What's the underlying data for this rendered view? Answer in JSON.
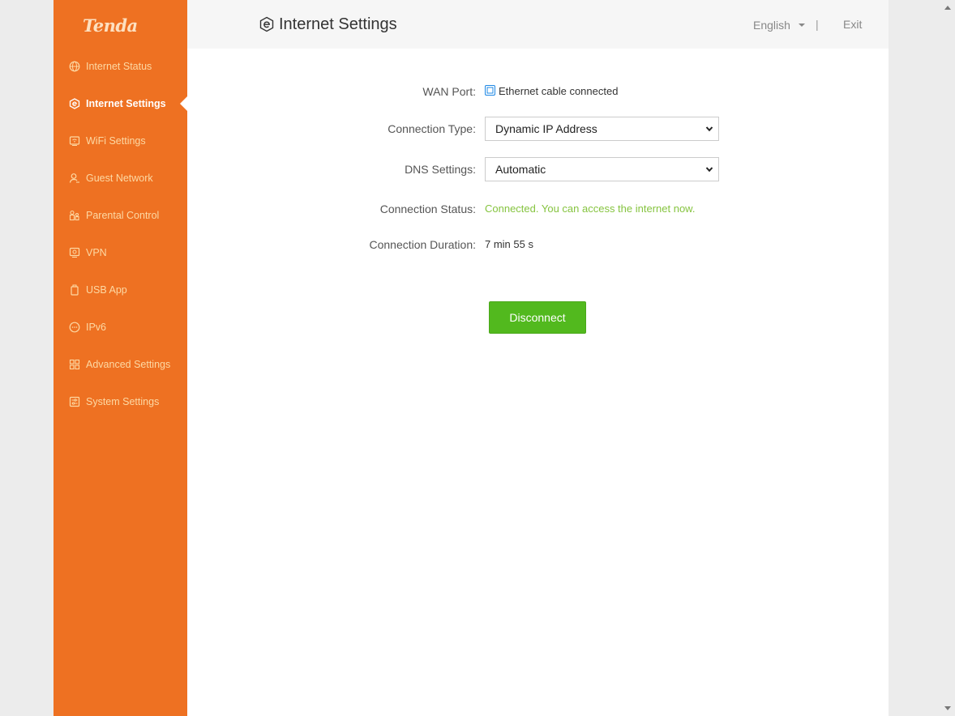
{
  "brand": {
    "logo_text": "Tenda"
  },
  "header": {
    "title": "Internet Settings",
    "title_icon": "internet-settings-icon",
    "language": "English",
    "divider": "|",
    "exit_label": "Exit"
  },
  "sidebar": {
    "accent_color": "#ee7122",
    "items": [
      {
        "label": "Internet Status",
        "icon": "globe-icon"
      },
      {
        "label": "Internet Settings",
        "icon": "hex-e-icon",
        "active": true
      },
      {
        "label": "WiFi Settings",
        "icon": "wifi-settings-icon"
      },
      {
        "label": "Guest Network",
        "icon": "guest-user-icon"
      },
      {
        "label": "Parental Control",
        "icon": "parental-control-icon"
      },
      {
        "label": "VPN",
        "icon": "vpn-icon"
      },
      {
        "label": "USB App",
        "icon": "usb-icon"
      },
      {
        "label": "IPv6",
        "icon": "ipv6-icon"
      },
      {
        "label": "Advanced Settings",
        "icon": "grid-icon"
      },
      {
        "label": "System Settings",
        "icon": "system-settings-icon"
      }
    ]
  },
  "form": {
    "wan_port": {
      "label": "WAN Port:",
      "value": "Ethernet cable connected"
    },
    "connection_type": {
      "label": "Connection Type:",
      "value": "Dynamic IP Address"
    },
    "dns_settings": {
      "label": "DNS Settings:",
      "value": "Automatic"
    },
    "connection_status": {
      "label": "Connection Status:",
      "value": "Connected. You can access the internet now."
    },
    "connection_duration": {
      "label": "Connection Duration:",
      "value": "7 min 55 s"
    }
  },
  "actions": {
    "disconnect_label": "Disconnect"
  },
  "colors": {
    "status_ok": "#86c440",
    "button_green": "#52b91e"
  }
}
